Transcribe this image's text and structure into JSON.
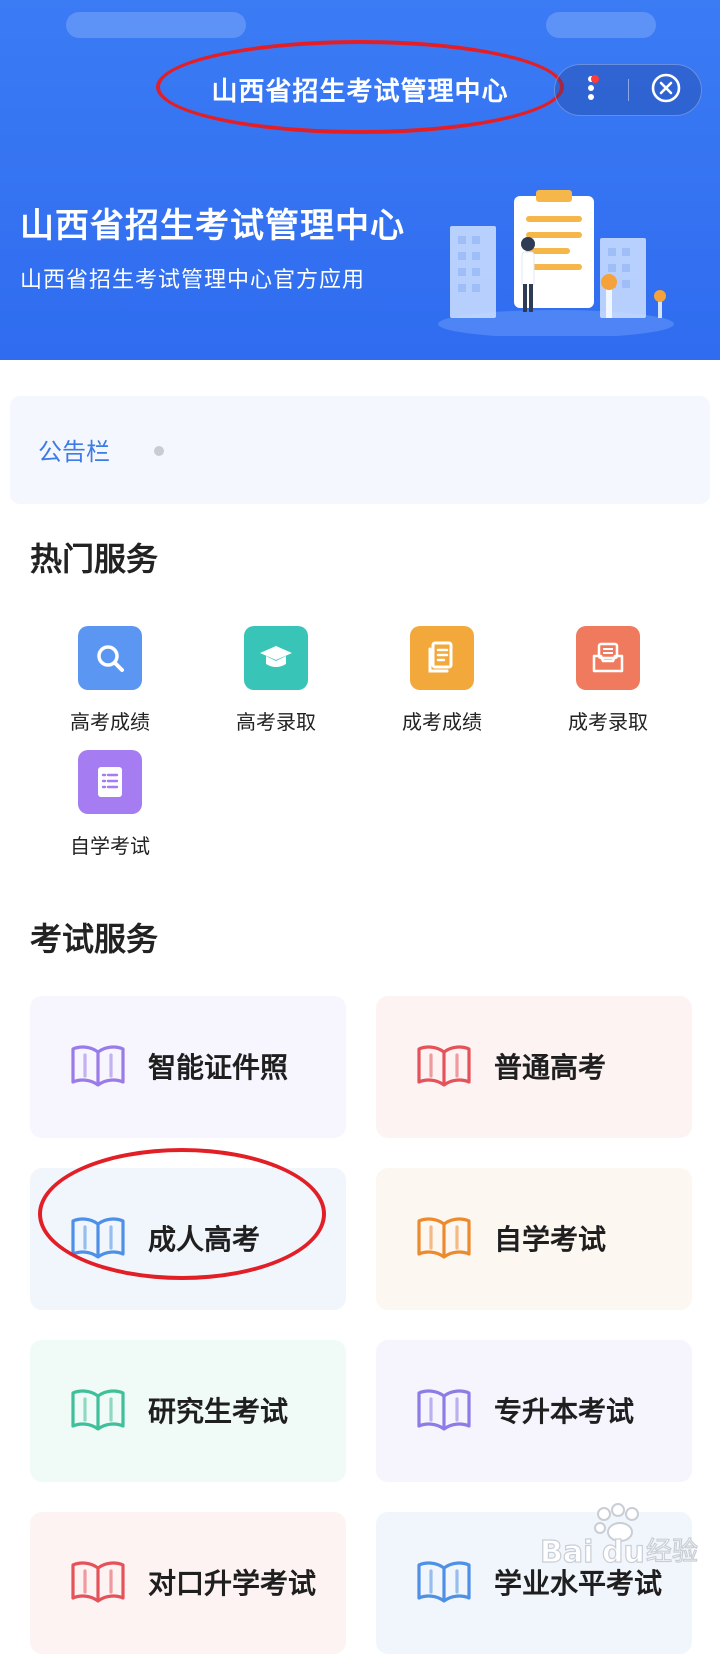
{
  "miniapp": {
    "title": "山西省招生考试管理中心"
  },
  "banner": {
    "title": "山西省招生考试管理中心",
    "subtitle": "山西省招生考试管理中心官方应用"
  },
  "notice": {
    "label": "公告栏"
  },
  "hot_services": {
    "title": "热门服务",
    "items": [
      {
        "label": "高考成绩",
        "icon": "search-icon",
        "color": "#5b97f2"
      },
      {
        "label": "高考录取",
        "icon": "graduation-cap-icon",
        "color": "#39c4b8"
      },
      {
        "label": "成考成绩",
        "icon": "document-icon",
        "color": "#f2a83a"
      },
      {
        "label": "成考录取",
        "icon": "inbox-icon",
        "color": "#f07a5e"
      },
      {
        "label": "自学考试",
        "icon": "checklist-icon",
        "color": "#a57cf1"
      }
    ]
  },
  "exam_services": {
    "title": "考试服务",
    "items": [
      {
        "label": "智能证件照",
        "icon": "book-icon",
        "color": "#9a7ce8",
        "bg": "#f7f5fd"
      },
      {
        "label": "普通高考",
        "icon": "book-icon",
        "color": "#e4535a",
        "bg": "#fdf3f3"
      },
      {
        "label": "成人高考",
        "icon": "book-icon",
        "color": "#4d90e6",
        "bg": "#f1f6fd"
      },
      {
        "label": "自学考试",
        "icon": "book-icon",
        "color": "#ec8a2e",
        "bg": "#fdf7f1"
      },
      {
        "label": "研究生考试",
        "icon": "book-icon",
        "color": "#3fbf9a",
        "bg": "#f0fbf7"
      },
      {
        "label": "专升本考试",
        "icon": "book-icon",
        "color": "#8e7ce6",
        "bg": "#f6f4fd"
      },
      {
        "label": "对口升学考试",
        "icon": "book-icon",
        "color": "#e4535a",
        "bg": "#fdf3f3"
      },
      {
        "label": "学业水平考试",
        "icon": "book-icon",
        "color": "#4d90e6",
        "bg": "#f1f6fd"
      }
    ]
  },
  "watermark": {
    "text": "Baidu经验"
  }
}
